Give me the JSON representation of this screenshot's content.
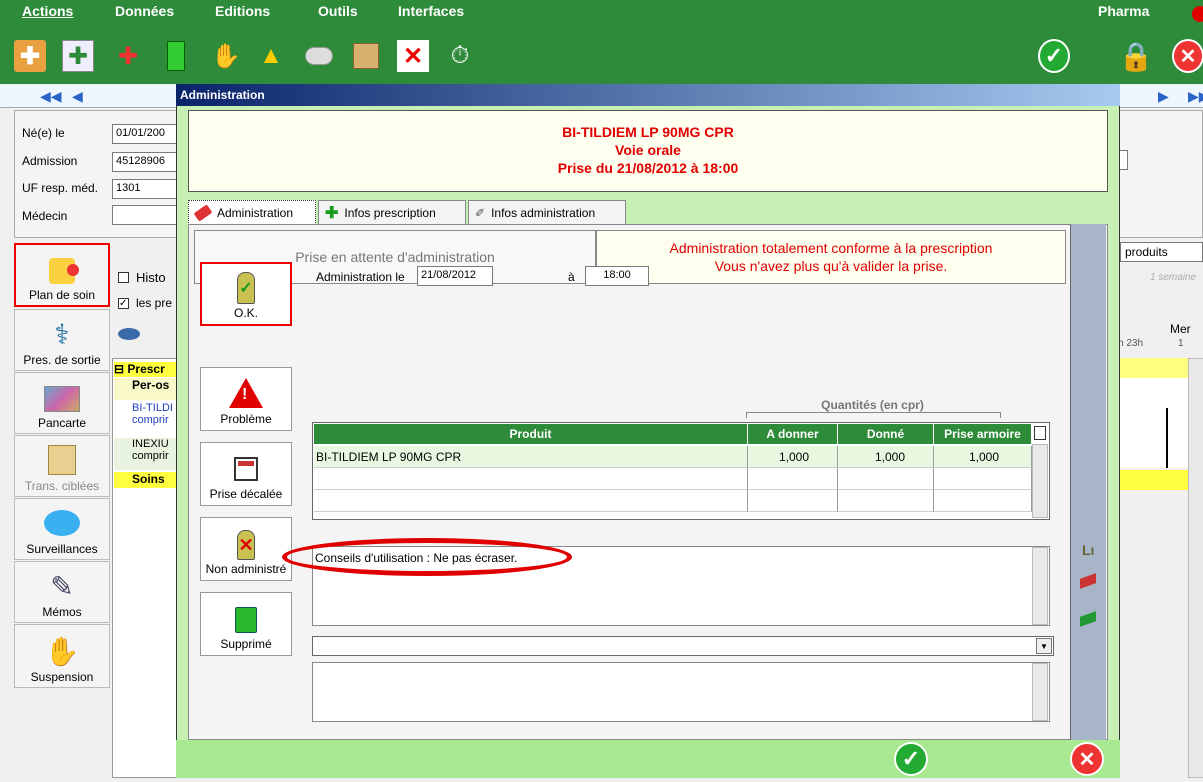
{
  "menu": {
    "actions": "Actions",
    "donnees": "Données",
    "editions": "Editions",
    "outils": "Outils",
    "interfaces": "Interfaces",
    "pharma": "Pharma"
  },
  "patient": {
    "born_label": "Né(e) le",
    "born_value": "01/01/200",
    "admission_label": "Admission",
    "admission_value": "45128906",
    "uf_label": "UF resp. méd.",
    "uf_value": "1301",
    "medecin_label": "Médecin",
    "medecin_value": ""
  },
  "sidebar": {
    "plan": "Plan de soin",
    "pres": "Pres. de sortie",
    "pancarte": "Pancarte",
    "trans": "Trans. ciblées",
    "surv": "Surveillances",
    "memos": "Mémos",
    "susp": "Suspension"
  },
  "mid": {
    "histo": "Histo",
    "les_pre": "les pre",
    "prescr": "Prescr",
    "per_os": "Per-os",
    "bi_tildi": "BI-TILDI",
    "compr1": "comprir",
    "inexiu": "INEXIU",
    "compr2": "comprir",
    "soins": "Soins"
  },
  "right": {
    "produits": "produits",
    "semaine": "1 semaine",
    "mer": "Mer",
    "hours": "h  23h",
    "day": "1"
  },
  "dialog": {
    "title": "Administration",
    "drug_name": "BI-TILDIEM LP 90MG CPR",
    "route": "Voie orale",
    "prise": "Prise du 21/08/2012 à 18:00",
    "tabs": [
      "Administration",
      "Infos prescription",
      "Infos administration"
    ],
    "status_left": "Prise en attente d'administration",
    "status_right_1": "Administration totalement conforme à la prescription",
    "status_right_2": "Vous n'avez plus qu'à valider la prise.",
    "btn_ok": "O.K.",
    "btn_probleme": "Problème",
    "btn_decalee": "Prise décalée",
    "btn_non_admin": "Non administré",
    "btn_supprime": "Supprimé",
    "admin_le_label": "Administration le",
    "admin_date": "21/08/2012",
    "a_label": "à",
    "admin_time": "18:00",
    "quantites": "Quantités (en cpr)",
    "table_headers": [
      "Produit",
      "A donner",
      "Donné",
      "Prise armoire"
    ],
    "rows": [
      {
        "produit": "BI-TILDIEM LP 90MG CPR",
        "a_donner": "1,000",
        "donne": "1,000",
        "armoire": "1,000"
      }
    ],
    "conseils": "Conseils d'utilisation : Ne pas écraser."
  },
  "colors": {
    "green": "#2e8b3a",
    "dialog_green": "#c9f0b4",
    "red": "#e00000",
    "title_blue": "#0a246a"
  }
}
